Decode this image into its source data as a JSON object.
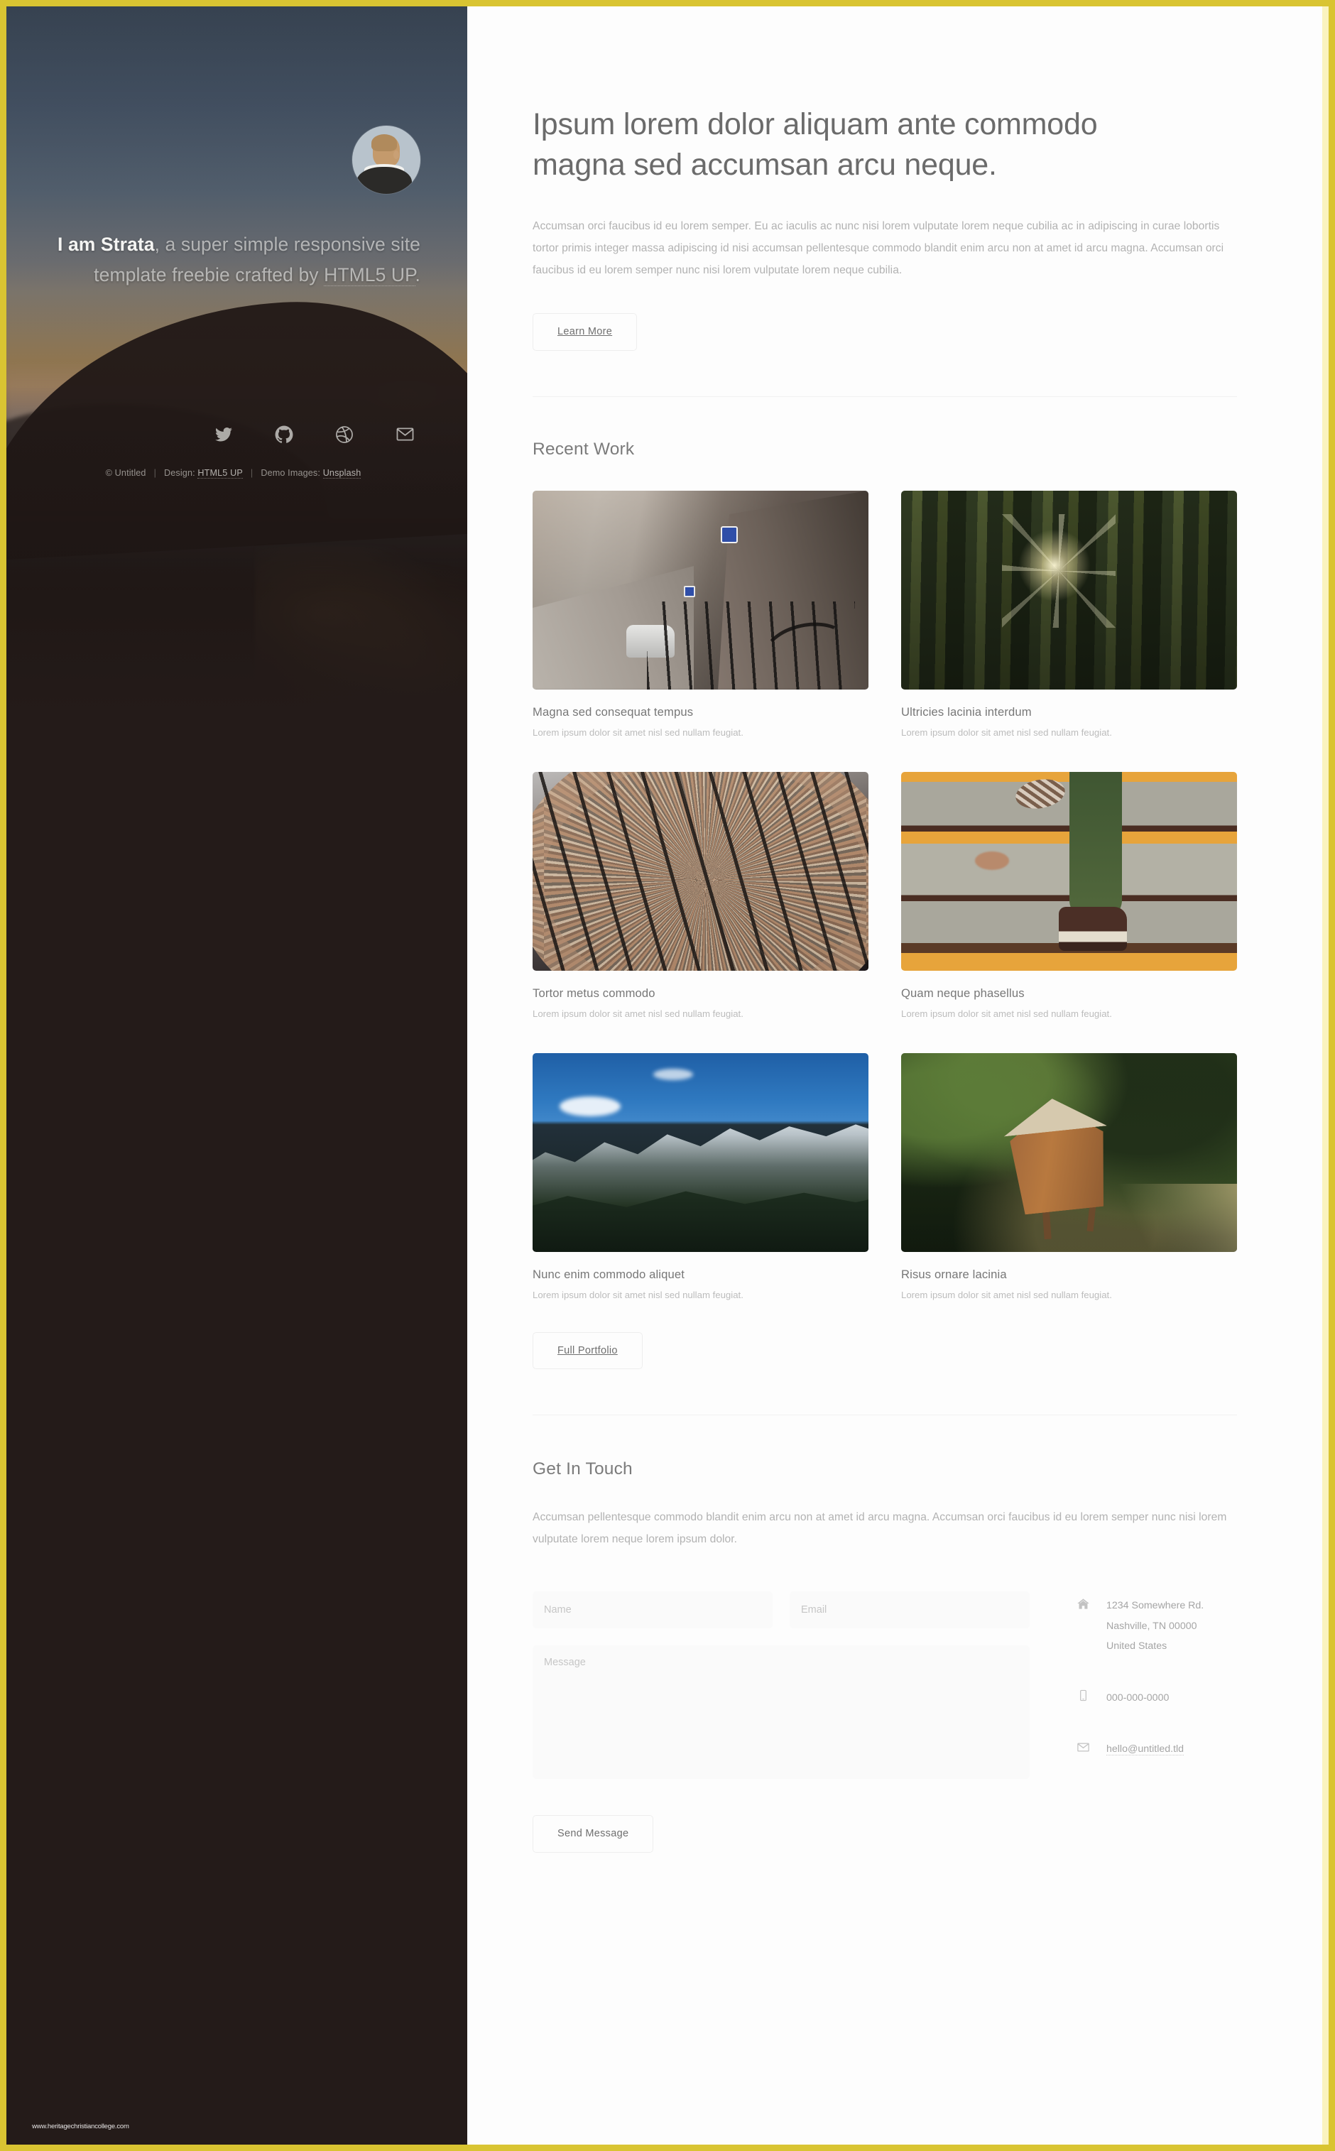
{
  "theme": {
    "accent_border": "#d9c432",
    "accent_border_inner": "#faf3bf",
    "sidebar_bg": "#241b19",
    "main_bg": "#fdfdfd",
    "heading_color": "#6b6b6b",
    "body_color": "#b2b2b2"
  },
  "sidebar": {
    "avatar_alt": "avatar",
    "headline_strong": "I am Strata",
    "headline_rest": ", a super simple responsive site template freebie crafted by ",
    "headline_link": "HTML5 UP",
    "headline_end": ".",
    "social": [
      {
        "name": "twitter-icon",
        "label": "Twitter"
      },
      {
        "name": "github-icon",
        "label": "GitHub"
      },
      {
        "name": "dribbble-icon",
        "label": "Dribbble"
      },
      {
        "name": "email-icon",
        "label": "Email"
      }
    ],
    "credits": {
      "copyright": "© Untitled",
      "design_label": "Design:",
      "design_link": "HTML5 UP",
      "images_label": "Demo Images:",
      "images_link": "Unsplash"
    },
    "watermark": "www.heritagechristiancollege.com"
  },
  "intro": {
    "title": "Ipsum lorem dolor aliquam ante commodo magna sed accumsan arcu neque.",
    "paragraph": "Accumsan orci faucibus id eu lorem semper. Eu ac iaculis ac nunc nisi lorem vulputate lorem neque cubilia ac in adipiscing in curae lobortis tortor primis integer massa adipiscing id nisi accumsan pellentesque commodo blandit enim arcu non at amet id arcu magna. Accumsan orci faucibus id eu lorem semper nunc nisi lorem vulputate lorem neque cubilia.",
    "cta_label": "Learn More"
  },
  "work": {
    "title": "Recent Work",
    "items": [
      {
        "title": "Magna sed consequat tempus",
        "caption": "Lorem ipsum dolor sit amet nisl sed nullam feugiat.",
        "image": "city-street-bicycles"
      },
      {
        "title": "Ultricies lacinia interdum",
        "caption": "Lorem ipsum dolor sit amet nisl sed nullam feugiat.",
        "image": "sunlit-forest"
      },
      {
        "title": "Tortor metus commodo",
        "caption": "Lorem ipsum dolor sit amet nisl sed nullam feugiat.",
        "image": "curved-library-shelves"
      },
      {
        "title": "Quam neque phasellus",
        "caption": "Lorem ipsum dolor sit amet nisl sed nullam feugiat.",
        "image": "feet-on-stairs"
      },
      {
        "title": "Nunc enim commodo aliquet",
        "caption": "Lorem ipsum dolor sit amet nisl sed nullam feugiat.",
        "image": "snowy-mountain-range"
      },
      {
        "title": "Risus ornare lacinia",
        "caption": "Lorem ipsum dolor sit amet nisl sed nullam feugiat.",
        "image": "wooden-cabin-in-forest"
      }
    ],
    "cta_label": "Full Portfolio"
  },
  "contact": {
    "title": "Get In Touch",
    "paragraph": "Accumsan pellentesque commodo blandit enim arcu non at amet id arcu magna. Accumsan orci faucibus id eu lorem semper nunc nisi lorem vulputate lorem neque lorem ipsum dolor.",
    "form": {
      "name_placeholder": "Name",
      "name_value": "",
      "email_placeholder": "Email",
      "email_value": "",
      "message_placeholder": "Message",
      "message_value": "",
      "submit_label": "Send Message"
    },
    "info": {
      "address_line1": "1234 Somewhere Rd.",
      "address_line2": "Nashville, TN 00000",
      "address_line3": "United States",
      "phone": "000-000-0000",
      "email": "hello@untitled.tld"
    }
  }
}
